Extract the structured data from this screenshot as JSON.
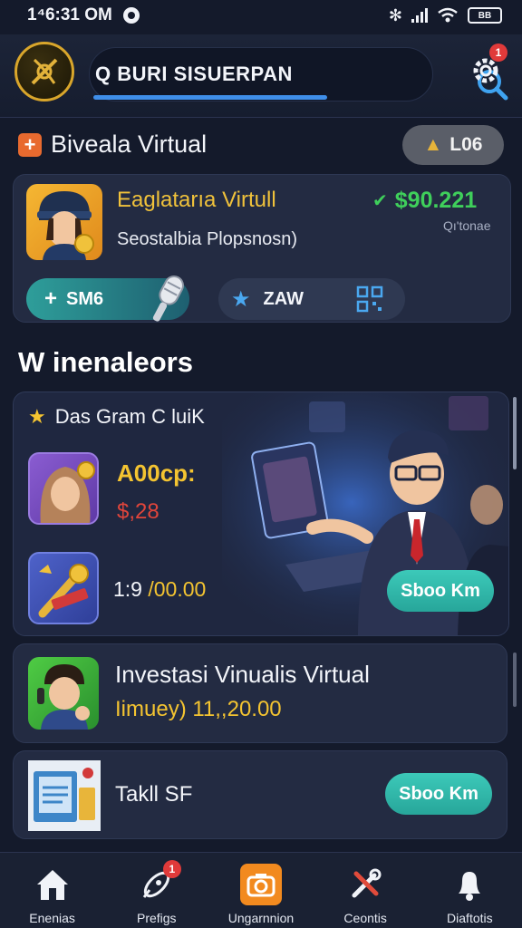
{
  "status_bar": {
    "time": "1⁴6:31 OM",
    "battery": "BB"
  },
  "header": {
    "search_text": "Q BURI SISUERPAN",
    "notification_count": "1",
    "accent": "#3f8ee8"
  },
  "section1": {
    "title": "Biveala Virtual",
    "log_button": "L06",
    "card": {
      "name": "Eaglatarıa Virtull",
      "subtitle": "Seostalbia Plopsnosn)",
      "amount": "$90.221",
      "meta": "Qı'tonae",
      "btn_primary": "SM6",
      "btn_secondary": "ZAW"
    }
  },
  "section2": {
    "title": "W inenaleors",
    "featured": {
      "heading": "Das Gram C luiK",
      "label": "A00cp:",
      "value": "$,28",
      "tools_prefix": "1:9",
      "tools_value": "/00.00",
      "button": "Sboo Km"
    },
    "item2": {
      "title": "Investasi Vinualis Virtual",
      "value": "Iimuey)  11,,20.00"
    },
    "item3": {
      "title": "Takll SF",
      "button": "Sboo Km"
    }
  },
  "bottom_nav": {
    "items": [
      {
        "label": "Enenias",
        "icon": "home-icon"
      },
      {
        "label": "Prefigs",
        "icon": "rocket-icon",
        "badge": "1"
      },
      {
        "label": "Ungarnnion",
        "icon": "camera-icon"
      },
      {
        "label": "Ceontis",
        "icon": "tools-icon"
      },
      {
        "label": "Diaftotis",
        "icon": "bell-icon"
      }
    ]
  },
  "colors": {
    "gold": "#f4c431",
    "green": "#3fcf5b",
    "red": "#e0453b",
    "teal": "#3cc9b9",
    "orange": "#f28a1f"
  }
}
